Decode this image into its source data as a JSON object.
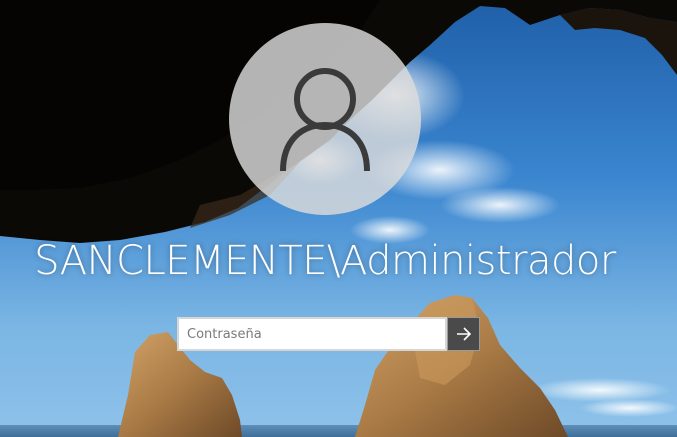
{
  "account": {
    "username": "SANCLEMENTE\\Administrador"
  },
  "password": {
    "placeholder": "Contraseña",
    "value": ""
  },
  "icons": {
    "avatar": "user-silhouette-icon",
    "submit": "arrow-right-icon"
  },
  "colors": {
    "text": "#ffffff",
    "avatar_background": "#dcdcdc",
    "submit_button": "#4a4a4a"
  }
}
